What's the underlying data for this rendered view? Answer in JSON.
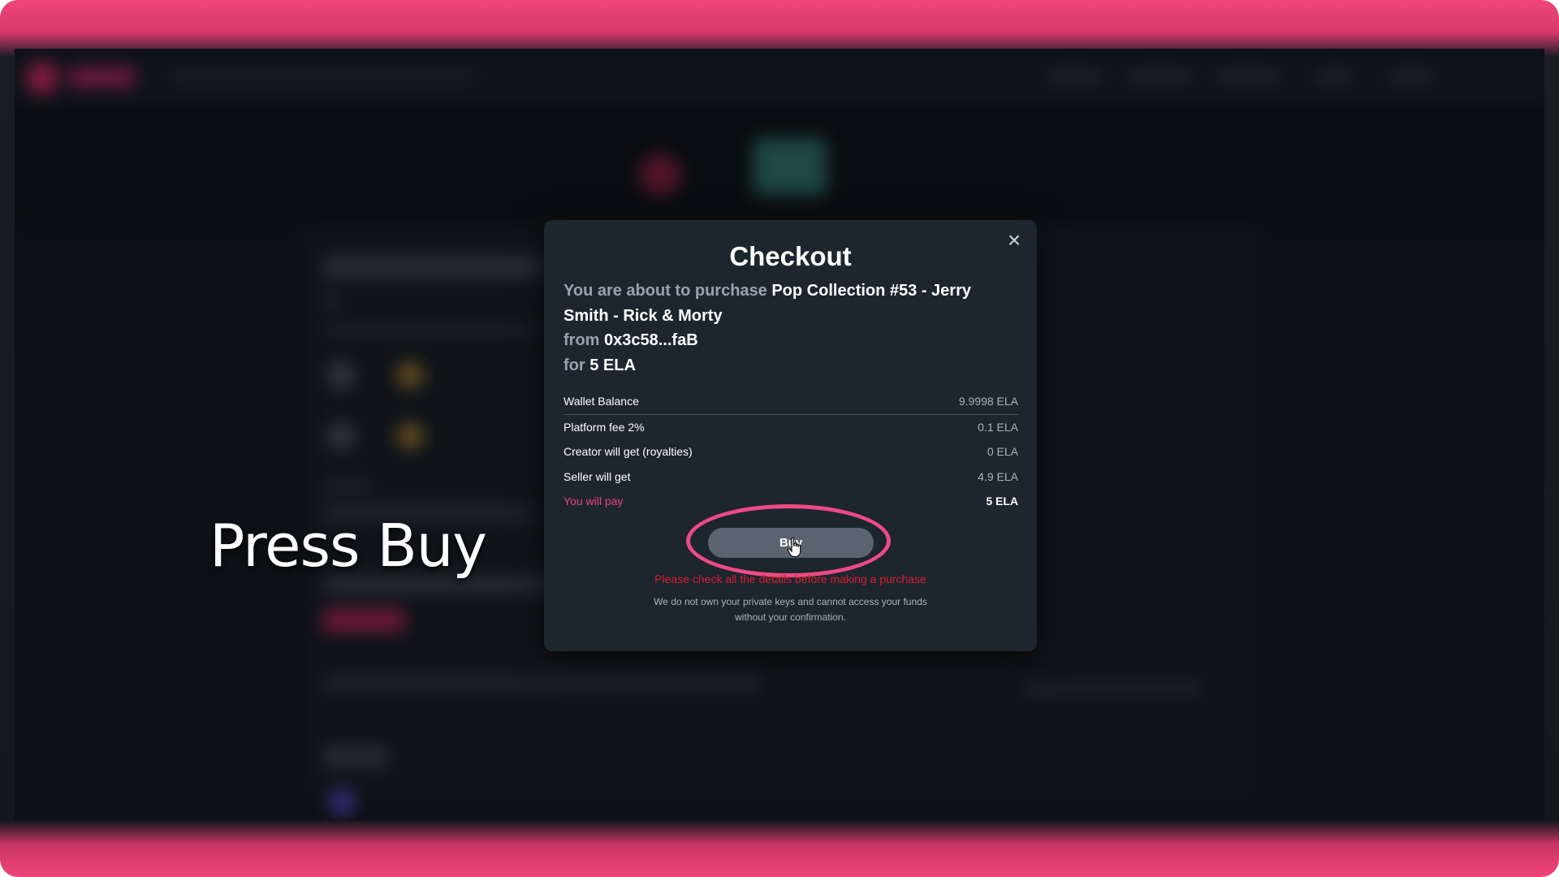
{
  "caption": "Press Buy",
  "modal": {
    "title": "Checkout",
    "close_icon": "close-icon",
    "intro_prefix": "You are about to purchase",
    "item_name": "Pop Collection #53 - Jerry Smith - Rick & Morty",
    "from_label": "from",
    "seller_address": "0x3c58...faB",
    "for_label": "for",
    "price": "5 ELA",
    "rows": [
      {
        "label": "Wallet Balance",
        "value": "9.9998 ELA"
      },
      {
        "label": "Platform fee 2%",
        "value": "0.1 ELA"
      },
      {
        "label": "Creator will get (royalties)",
        "value": "0 ELA"
      },
      {
        "label": "Seller will get",
        "value": "4.9 ELA"
      },
      {
        "label": "You will pay",
        "value": "5 ELA"
      }
    ],
    "buy_label": "Buy",
    "warning": "Please check all the details before making a purchase",
    "note": "We do not own your private keys and cannot access your funds without your confirmation."
  },
  "colors": {
    "frame_pink": "#f0457a",
    "modal_bg": "#1d252f",
    "highlight": "#ee4a85",
    "pay_label": "#e8447a",
    "warning": "#d61f2e"
  }
}
